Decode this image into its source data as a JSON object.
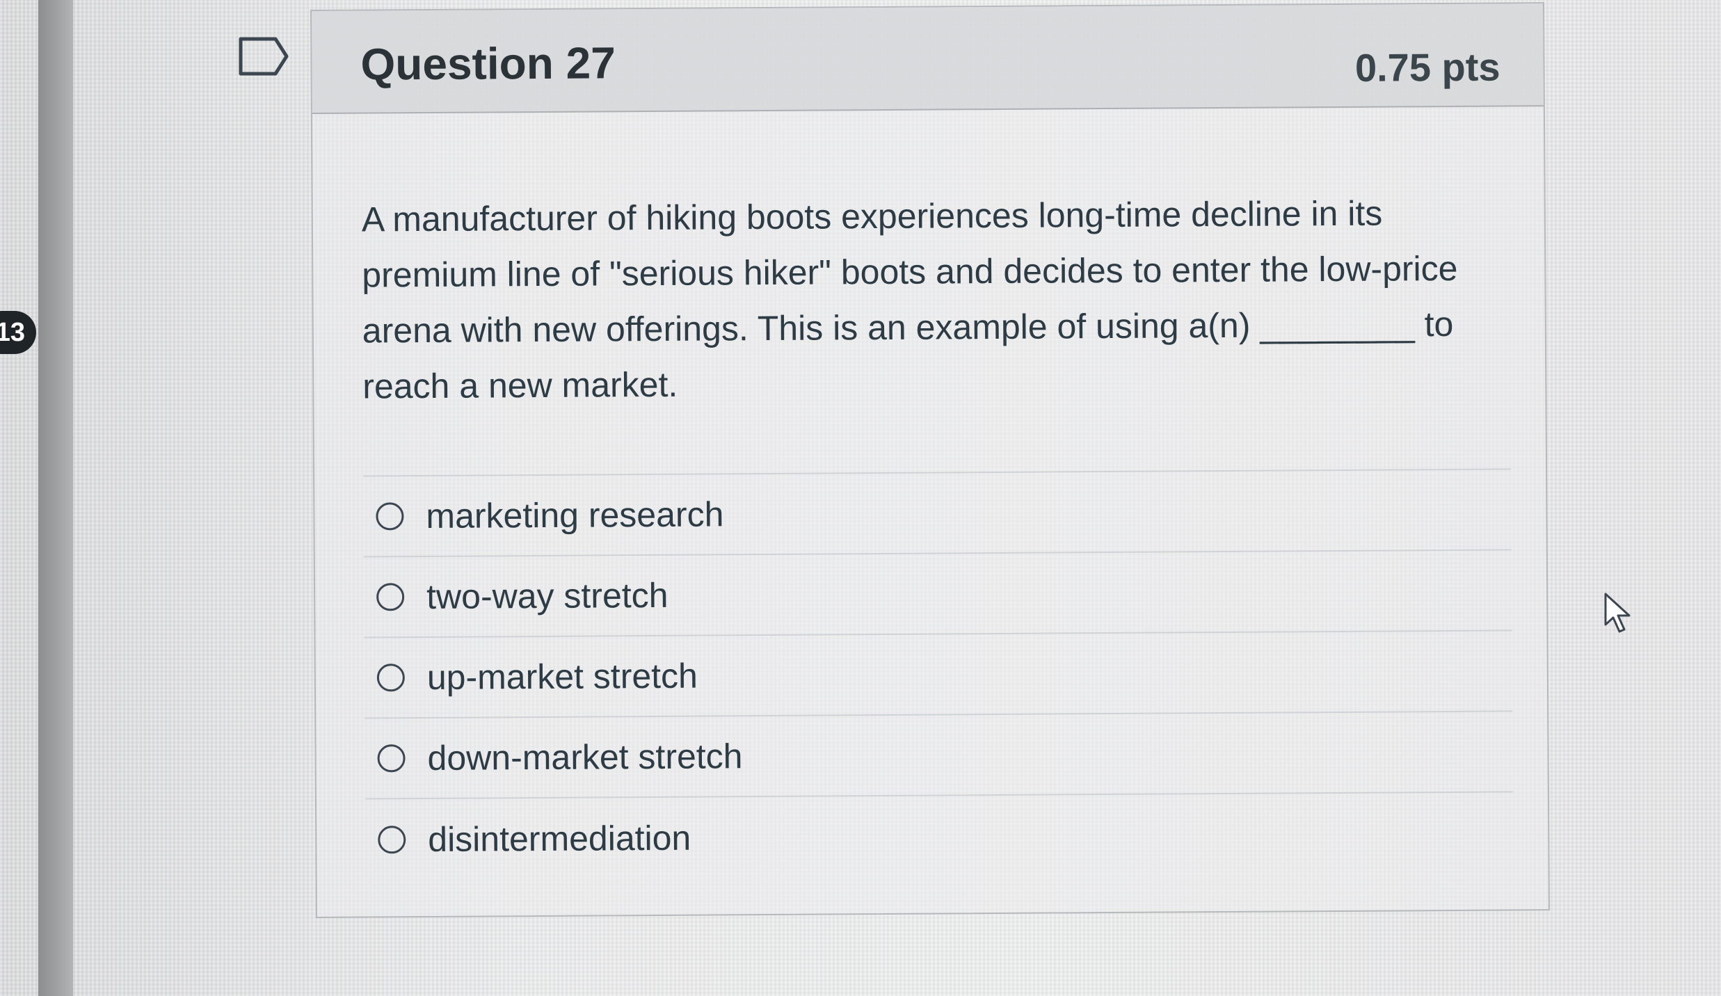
{
  "sidebar": {
    "question_number_badge": "13"
  },
  "question": {
    "flag_icon": "flag-outline-icon",
    "title": "Question 27",
    "points": "0.75 pts",
    "text": "A manufacturer of hiking boots experiences long-time decline in its premium line of \"serious hiker\" boots and decides to enter the low-price arena with new offerings. This is an example of using a(n) ________ to reach a new market.",
    "answers": [
      {
        "label": "marketing research",
        "selected": false
      },
      {
        "label": "two-way stretch",
        "selected": false
      },
      {
        "label": "up-market stretch",
        "selected": false
      },
      {
        "label": "down-market stretch",
        "selected": false
      },
      {
        "label": "disintermediation",
        "selected": false
      }
    ]
  },
  "cursor": {
    "icon": "mouse-pointer-icon"
  }
}
